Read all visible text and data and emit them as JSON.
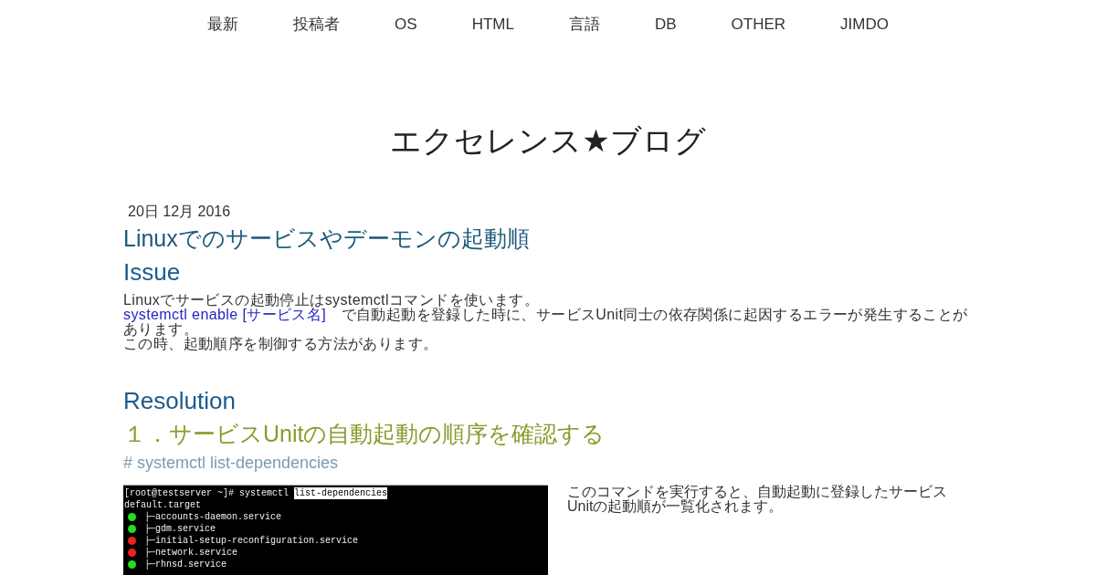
{
  "nav": {
    "items": [
      "最新",
      "投稿者",
      "OS",
      "HTML",
      "言語",
      "DB",
      "OTHER",
      "JIMDO"
    ]
  },
  "blog_title": "エクセレンス★ブログ",
  "post": {
    "date": "20日 12月 2016",
    "title": "Linuxでのサービスやデーモンの起動順"
  },
  "issue": {
    "heading": "Issue",
    "lines": [
      {
        "text": "Linuxでサービスの起動停止はsystemctlコマンドを使います。"
      },
      {
        "link": "systemctl enable [サービス名]",
        "text": "　で自動起動を登録した時に、サービスUnit同士の依存関係に起因するエラーが発生することがあります。"
      },
      {
        "text": "この時、起動順序を制御する方法があります。"
      }
    ]
  },
  "resolution": {
    "heading": "Resolution",
    "step_heading": "１．サービスUnitの自動起動の順序を確認する",
    "command": "# systemctl list-dependencies",
    "terminal": {
      "prompt": "[root@testserver ~]# systemctl",
      "selection": "list-dependencies",
      "lines": [
        {
          "kind": "plain",
          "text": "default.target"
        },
        {
          "kind": "unit",
          "color": "#22dd22",
          "text": "├─accounts-daemon.service"
        },
        {
          "kind": "unit",
          "color": "#22dd22",
          "text": "├─gdm.service"
        },
        {
          "kind": "unit",
          "color": "#ee2222",
          "text": "├─initial-setup-reconfiguration.service"
        },
        {
          "kind": "unit",
          "color": "#ee2222",
          "text": "├─network.service"
        },
        {
          "kind": "unit",
          "color": "#22dd22",
          "text": "├─rhnsd.service"
        }
      ]
    },
    "description": "このコマンドを実行すると、自動起動に登録したサービスUnitの起動順が一覧化されます。"
  }
}
